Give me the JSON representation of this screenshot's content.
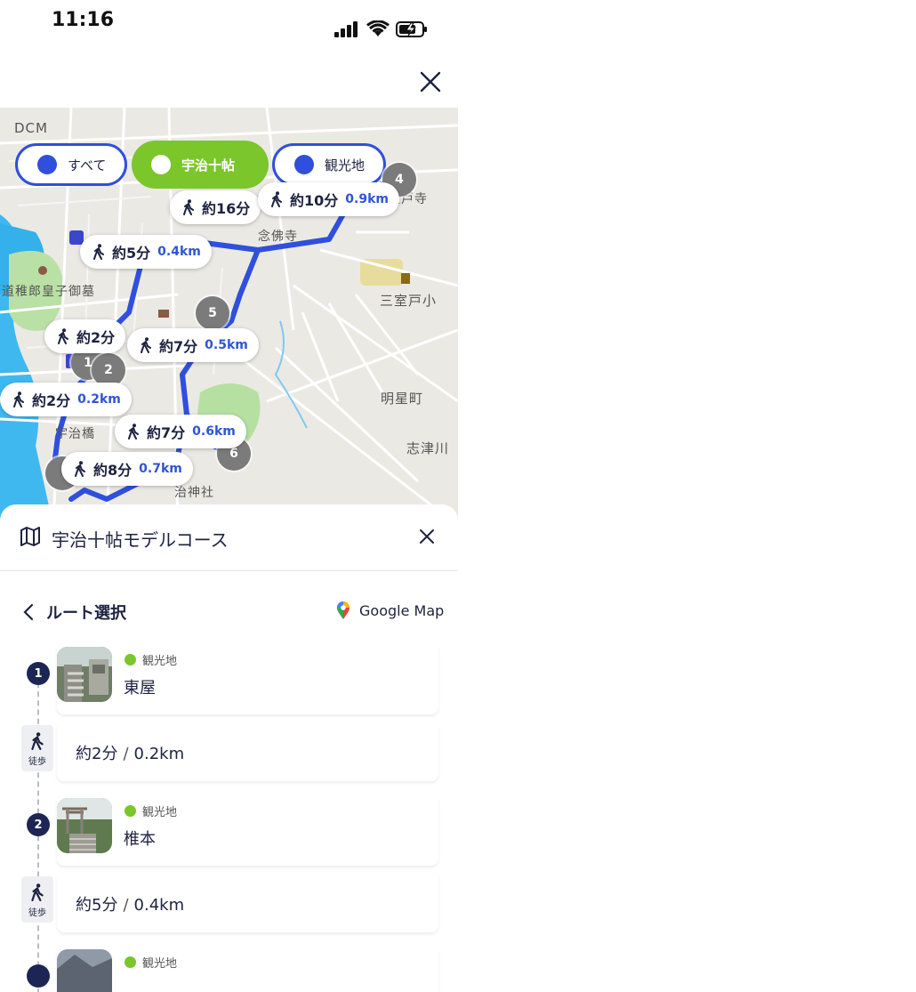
{
  "status_bar": {
    "time": "11:16"
  },
  "map": {
    "filters": [
      {
        "label": "すべて",
        "active": false
      },
      {
        "label": "宇治十帖",
        "active": true
      },
      {
        "label": "観光地",
        "active": false
      }
    ],
    "walk_bubbles": [
      {
        "time": "約16分",
        "distance": ""
      },
      {
        "time": "約10分",
        "distance": "0.9km"
      },
      {
        "time": "約5分",
        "distance": "0.4km"
      },
      {
        "time": "約2分",
        "distance": ""
      },
      {
        "time": "約7分",
        "distance": "0.5km"
      },
      {
        "time": "約2分",
        "distance": "0.2km"
      },
      {
        "time": "約7分",
        "distance": "0.6km"
      },
      {
        "time": "約8分",
        "distance": "0.7km"
      }
    ],
    "markers": [
      "1",
      "2",
      "4",
      "5",
      "6"
    ],
    "place_labels": {
      "dcm": "DCM",
      "tomb": "道稚郎皇子御墓",
      "school": "三室戸小",
      "meisei": "明星町",
      "shizugawa": "志津川",
      "ujibashi": "宇治橋",
      "nenbutsu": "念佛寺",
      "shrine": "治神社",
      "temple": "室戸寺"
    },
    "colors": {
      "route": "#2f4fdc",
      "active_filter": "#7ac62b"
    }
  },
  "sheet": {
    "title": "宇治十帖モデルコース",
    "back_label": "ルート選択",
    "google_map_label": "Google Map",
    "steps": [
      {
        "number": "1",
        "category": "観光地",
        "name": "東屋"
      },
      {
        "number": "2",
        "category": "観光地",
        "name": "椎本"
      },
      {
        "number": "",
        "category": "観光地",
        "name": ""
      }
    ],
    "walks": [
      {
        "badge": "徒歩",
        "time": "約2分",
        "separator": "/",
        "distance": "0.2km"
      },
      {
        "badge": "徒歩",
        "time": "約5分",
        "separator": "/",
        "distance": "0.4km"
      }
    ]
  }
}
